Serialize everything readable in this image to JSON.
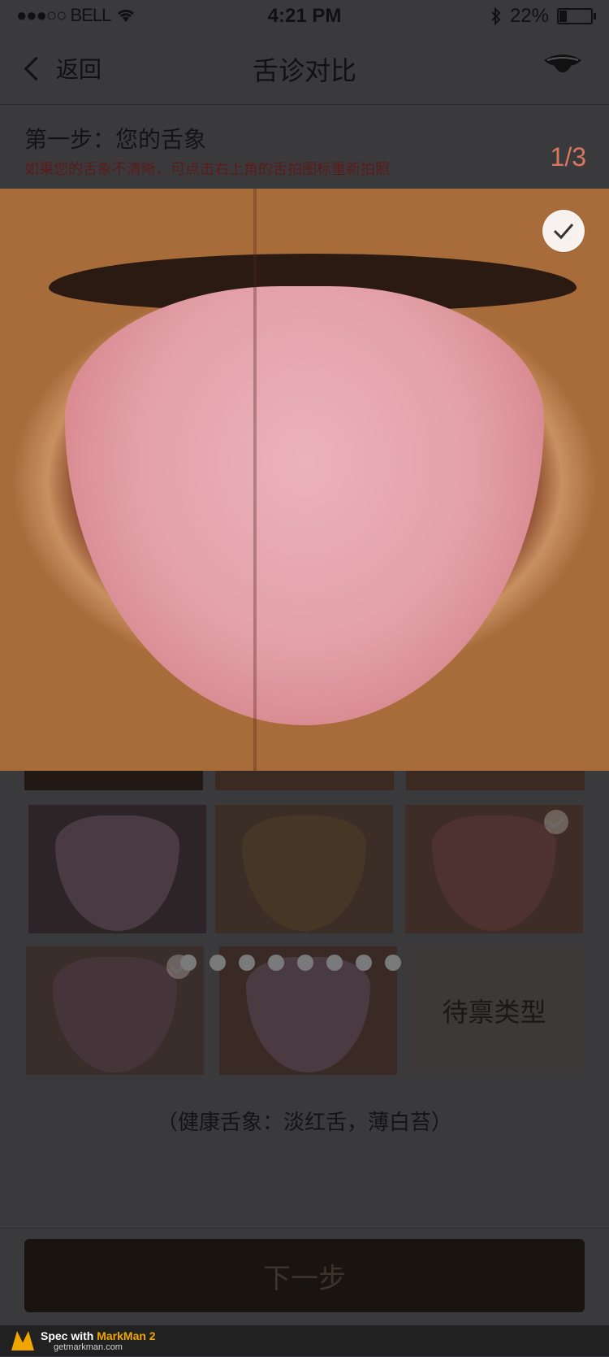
{
  "status": {
    "carrier": "●●●○○ BELL",
    "time": "4:21 PM",
    "battery": "22%"
  },
  "nav": {
    "back": "返回",
    "title": "舌诊对比",
    "tongue_icon": "tongue-mouth-icon"
  },
  "header": {
    "step": "第一步：您的舌象",
    "hint": "如果您的舌象不清晰，可点击右上角的舌拍图标重新拍照",
    "counter": "1/3"
  },
  "types_label": "待禀类型",
  "caption": "（健康舌象：淡红舌，薄白苔）",
  "next": "下一步",
  "pager": {
    "count": 9
  },
  "colors": {
    "background": "#3a3a3c",
    "accent": "#f45f41",
    "button": "#1a1410"
  },
  "markman": {
    "line1_prefix": "Spec with ",
    "line1_brand": "MarkMan 2",
    "line2": "getmarkman.com"
  }
}
